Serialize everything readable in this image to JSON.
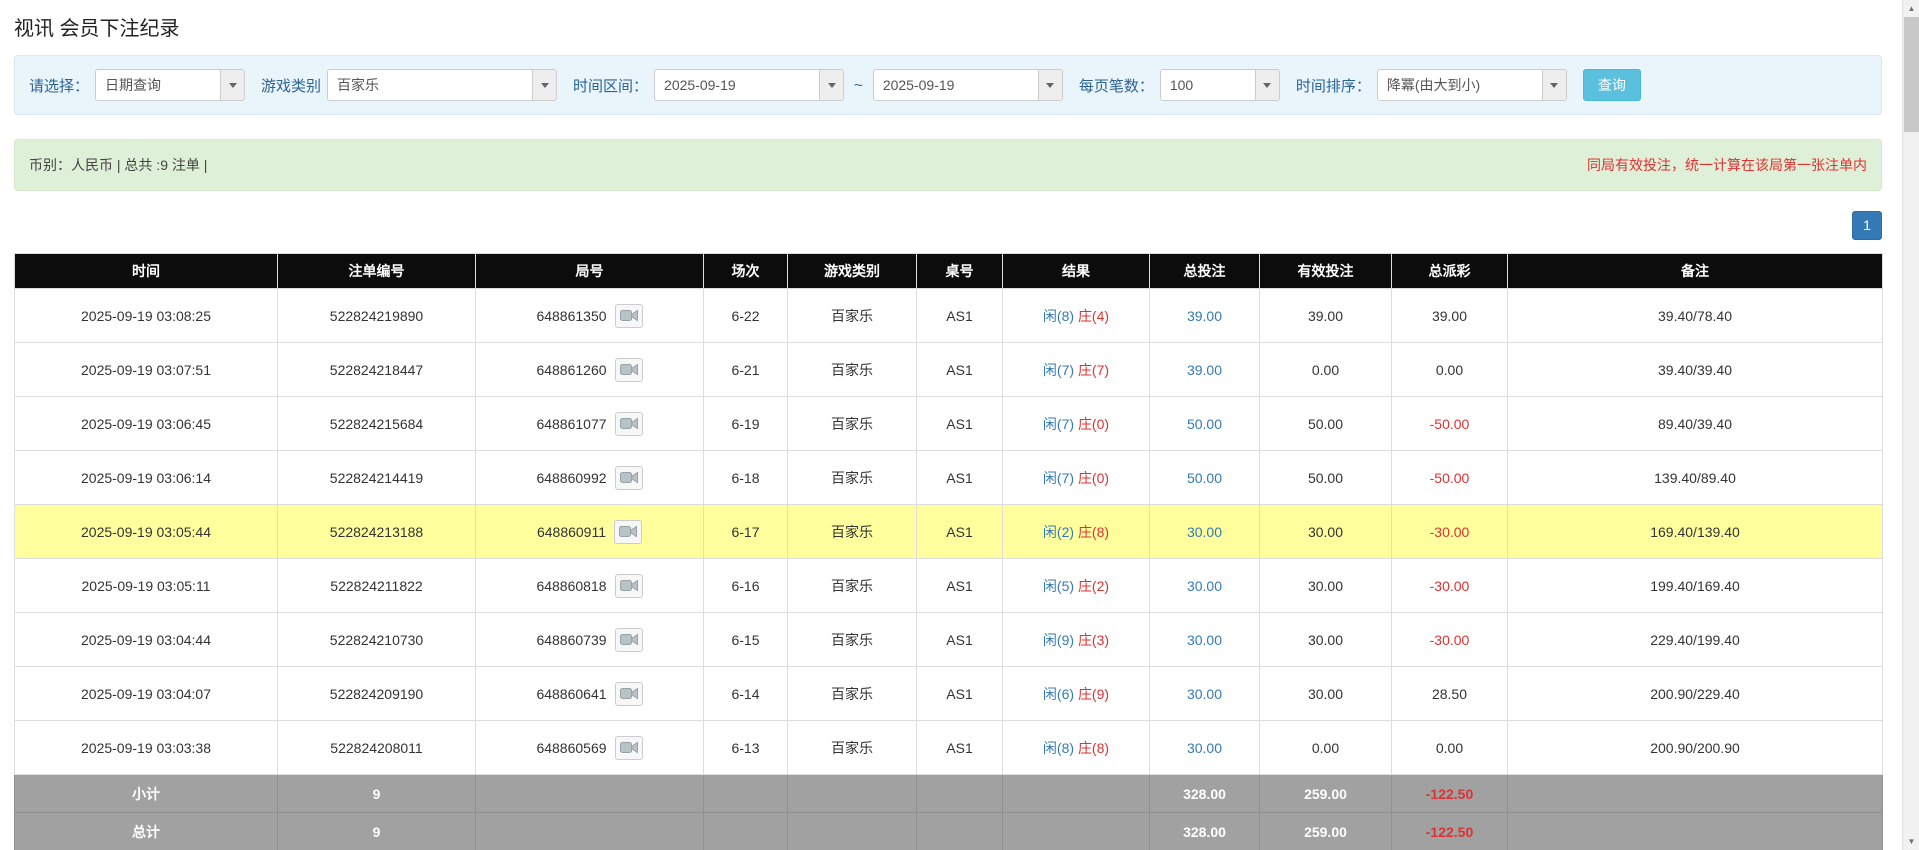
{
  "colors": {
    "accent_blue": "#337ab7",
    "label_blue": "#2a6496",
    "player_blue": "#337ab7",
    "banker_red": "#e03131",
    "negative_red": "#e03131",
    "highlight_yellow": "#ffff9e",
    "header_black": "#0c0c0c",
    "footer_gray": "#a1a1a1",
    "search_button_cyan": "#5bc0de",
    "summary_green_bg": "#dff0d8",
    "filter_bar_bg": "#eaf4fb"
  },
  "page": {
    "title": "视讯 会员下注纪录"
  },
  "filters": {
    "select_label": "请选择：",
    "select_value": "日期查询",
    "game_type_label": "游戏类别",
    "game_type_value": "百家乐",
    "time_range_label": "时间区间：",
    "time_from": "2025-09-19",
    "range_separator": "~",
    "time_to": "2025-09-19",
    "page_size_label": "每页笔数：",
    "page_size_value": "100",
    "sort_label": "时间排序：",
    "sort_value": "降冪(由大到小)",
    "search_button_label": "查询"
  },
  "summary_bar": {
    "left_text": "币别：人民币 | 总共 :9 注单 |",
    "right_text": "同局有效投注，统一计算在该局第一张注单内"
  },
  "pagination": {
    "current_page": "1"
  },
  "table": {
    "headers": [
      "时间",
      "注单编号",
      "局号",
      "场次",
      "游戏类别",
      "桌号",
      "结果",
      "总投注",
      "有效投注",
      "总派彩",
      "备注"
    ],
    "rows": [
      {
        "time": "2025-09-19 03:08:25",
        "bet_id": "522824219890",
        "round_id": "648861350",
        "session": "6-22",
        "game": "百家乐",
        "table_no": "AS1",
        "result_player": "闲(8)",
        "result_banker": "庄(4)",
        "total_bet": "39.00",
        "valid_bet": "39.00",
        "payout": "39.00",
        "note": "39.40/78.40",
        "highlight": false
      },
      {
        "time": "2025-09-19 03:07:51",
        "bet_id": "522824218447",
        "round_id": "648861260",
        "session": "6-21",
        "game": "百家乐",
        "table_no": "AS1",
        "result_player": "闲(7)",
        "result_banker": "庄(7)",
        "total_bet": "39.00",
        "valid_bet": "0.00",
        "payout": "0.00",
        "note": "39.40/39.40",
        "highlight": false
      },
      {
        "time": "2025-09-19 03:06:45",
        "bet_id": "522824215684",
        "round_id": "648861077",
        "session": "6-19",
        "game": "百家乐",
        "table_no": "AS1",
        "result_player": "闲(7)",
        "result_banker": "庄(0)",
        "total_bet": "50.00",
        "valid_bet": "50.00",
        "payout": "-50.00",
        "note": "89.40/39.40",
        "highlight": false
      },
      {
        "time": "2025-09-19 03:06:14",
        "bet_id": "522824214419",
        "round_id": "648860992",
        "session": "6-18",
        "game": "百家乐",
        "table_no": "AS1",
        "result_player": "闲(7)",
        "result_banker": "庄(0)",
        "total_bet": "50.00",
        "valid_bet": "50.00",
        "payout": "-50.00",
        "note": "139.40/89.40",
        "highlight": false
      },
      {
        "time": "2025-09-19 03:05:44",
        "bet_id": "522824213188",
        "round_id": "648860911",
        "session": "6-17",
        "game": "百家乐",
        "table_no": "AS1",
        "result_player": "闲(2)",
        "result_banker": "庄(8)",
        "total_bet": "30.00",
        "valid_bet": "30.00",
        "payout": "-30.00",
        "note": "169.40/139.40",
        "highlight": true
      },
      {
        "time": "2025-09-19 03:05:11",
        "bet_id": "522824211822",
        "round_id": "648860818",
        "session": "6-16",
        "game": "百家乐",
        "table_no": "AS1",
        "result_player": "闲(5)",
        "result_banker": "庄(2)",
        "total_bet": "30.00",
        "valid_bet": "30.00",
        "payout": "-30.00",
        "note": "199.40/169.40",
        "highlight": false
      },
      {
        "time": "2025-09-19 03:04:44",
        "bet_id": "522824210730",
        "round_id": "648860739",
        "session": "6-15",
        "game": "百家乐",
        "table_no": "AS1",
        "result_player": "闲(9)",
        "result_banker": "庄(3)",
        "total_bet": "30.00",
        "valid_bet": "30.00",
        "payout": "-30.00",
        "note": "229.40/199.40",
        "highlight": false
      },
      {
        "time": "2025-09-19 03:04:07",
        "bet_id": "522824209190",
        "round_id": "648860641",
        "session": "6-14",
        "game": "百家乐",
        "table_no": "AS1",
        "result_player": "闲(6)",
        "result_banker": "庄(9)",
        "total_bet": "30.00",
        "valid_bet": "30.00",
        "payout": "28.50",
        "note": "200.90/229.40",
        "highlight": false
      },
      {
        "time": "2025-09-19 03:03:38",
        "bet_id": "522824208011",
        "round_id": "648860569",
        "session": "6-13",
        "game": "百家乐",
        "table_no": "AS1",
        "result_player": "闲(8)",
        "result_banker": "庄(8)",
        "total_bet": "30.00",
        "valid_bet": "0.00",
        "payout": "0.00",
        "note": "200.90/200.90",
        "highlight": false
      }
    ],
    "footer_rows": [
      {
        "label": "小计",
        "bet_count": "9",
        "total_bet": "328.00",
        "valid_bet": "259.00",
        "payout": "-122.50"
      },
      {
        "label": "总计",
        "bet_count": "9",
        "total_bet": "328.00",
        "valid_bet": "259.00",
        "payout": "-122.50"
      }
    ]
  }
}
